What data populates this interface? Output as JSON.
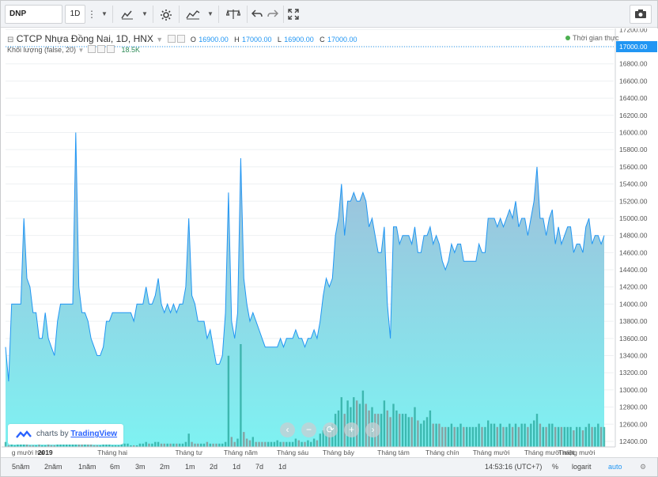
{
  "toolbar": {
    "symbol": "DNP",
    "interval": "1D",
    "icons": [
      "more-icon",
      "compare-icon",
      "settings-icon",
      "indicators-icon",
      "templates-icon",
      "undo-icon",
      "redo-icon",
      "fullscreen-icon",
      "camera-icon"
    ]
  },
  "legend": {
    "title": "CTCP Nhựa Đồng Nai, 1D, HNX",
    "open_label": "O",
    "open": "16900.00",
    "high_label": "H",
    "high": "17000.00",
    "low_label": "L",
    "low": "16900.00",
    "close_label": "C",
    "close": "17000.00",
    "volume_label": "Khối lượng (false, 20)",
    "volume_value": "18.5K",
    "realtime": "Thời gian thực"
  },
  "branding": {
    "prefix": "charts by",
    "name": "TradingView"
  },
  "bottombar": {
    "ranges": [
      "5năm",
      "2năm",
      "1năm",
      "6m",
      "3m",
      "2m",
      "1m",
      "2d",
      "1d",
      "7d",
      "1d"
    ],
    "clock": "14:53:16",
    "timezone": "(UTC+7)",
    "percent": "%",
    "log": "logarit",
    "auto": "auto"
  },
  "colors": {
    "line": "#2196f3",
    "fill_top": "#a3b9d8",
    "fill_bottom": "#7ef2f2",
    "vol_up": "#26a69a",
    "vol_down": "#888888",
    "price_tag": "#2196f3"
  },
  "chart_data": {
    "type": "area",
    "series_ohlc_last": {
      "open": 16900,
      "high": 17000,
      "low": 16900,
      "close": 17000
    },
    "y_ticks": [
      12400,
      12600,
      12800,
      13000,
      13200,
      13400,
      13600,
      13800,
      14000,
      14200,
      14400,
      14600,
      14800,
      15000,
      15200,
      15400,
      15600,
      15800,
      16000,
      16200,
      16400,
      16600,
      16800,
      17000,
      17200
    ],
    "y_tick_labels": [
      "12400.00",
      "12600.00",
      "12800.00",
      "13000.00",
      "13200.00",
      "13400.00",
      "13600.00",
      "13800.00",
      "14000.00",
      "14200.00",
      "14400.00",
      "14600.00",
      "14800.00",
      "15000.00",
      "15200.00",
      "15400.00",
      "15600.00",
      "15800.00",
      "16000.00",
      "16200.00",
      "16400.00",
      "16600.00",
      "16800.00",
      "17000.00",
      "17200.00"
    ],
    "ylim": [
      12300,
      17250
    ],
    "last_price_label": "17000.00",
    "x_labels": [
      {
        "label": "g mười hai",
        "i": 2
      },
      {
        "label": "2019",
        "i": 13
      },
      {
        "label": "Tháng hai",
        "i": 35
      },
      {
        "label": "Tháng tư",
        "i": 60
      },
      {
        "label": "Tháng năm",
        "i": 77
      },
      {
        "label": "Tháng sáu",
        "i": 94
      },
      {
        "label": "Tháng bảy",
        "i": 109
      },
      {
        "label": "Tháng tám",
        "i": 127
      },
      {
        "label": "Tháng chín",
        "i": 143
      },
      {
        "label": "Tháng mười",
        "i": 159
      },
      {
        "label": "Tháng mười một",
        "i": 178
      },
      {
        "label": "Tháng mười",
        "i": 193
      }
    ],
    "close": [
      13500,
      13100,
      14000,
      14000,
      14000,
      14000,
      15000,
      14300,
      14200,
      13900,
      13900,
      13600,
      13600,
      13900,
      13600,
      13500,
      13400,
      13800,
      14000,
      14000,
      14000,
      14000,
      14000,
      16000,
      14200,
      13900,
      13900,
      13800,
      13600,
      13500,
      13400,
      13400,
      13500,
      13800,
      13800,
      13900,
      13900,
      13900,
      13900,
      13900,
      13900,
      13900,
      13800,
      14000,
      14000,
      14000,
      14200,
      14000,
      14000,
      14100,
      14300,
      14000,
      13900,
      14000,
      13900,
      14000,
      13900,
      14000,
      14000,
      14200,
      15000,
      14100,
      14000,
      13800,
      13800,
      13800,
      13600,
      13700,
      13500,
      13300,
      13300,
      13400,
      13900,
      15300,
      13800,
      13600,
      13900,
      15700,
      14300,
      14000,
      13800,
      13900,
      13800,
      13700,
      13600,
      13500,
      13500,
      13500,
      13500,
      13500,
      13600,
      13500,
      13600,
      13600,
      13600,
      13700,
      13600,
      13600,
      13500,
      13600,
      13600,
      13700,
      13600,
      13800,
      14100,
      14300,
      14200,
      14300,
      14800,
      15000,
      15400,
      14800,
      15200,
      15200,
      15300,
      15200,
      15200,
      15300,
      15200,
      14900,
      15000,
      14800,
      14600,
      14600,
      14900,
      14000,
      13600,
      14900,
      14900,
      14700,
      14800,
      14800,
      14800,
      14700,
      14900,
      14600,
      14600,
      14800,
      14800,
      14900,
      14700,
      14800,
      14700,
      14500,
      14400,
      14500,
      14700,
      14600,
      14700,
      14700,
      14500,
      14500,
      14500,
      14500,
      14500,
      14700,
      14600,
      14600,
      15000,
      15000,
      15000,
      14900,
      15000,
      14900,
      15000,
      15100,
      15000,
      15200,
      14900,
      15000,
      15000,
      14800,
      15000,
      15200,
      15600,
      15000,
      15000,
      14800,
      15000,
      15100,
      14700,
      14900,
      14700,
      14800,
      14900,
      14900,
      14600,
      14700,
      14700,
      14600,
      14900,
      15000,
      14700,
      14800,
      14800,
      14700,
      14800
    ],
    "volume_bars_note": "volume histogram drawn along bottom pane (values in arbitrary units read from pane height)",
    "volume": [
      3,
      1,
      2,
      1,
      2,
      2,
      4,
      2,
      1,
      1,
      1,
      2,
      1,
      1,
      2,
      1,
      1,
      2,
      2,
      3,
      2,
      2,
      2,
      10,
      4,
      2,
      3,
      2,
      2,
      1,
      1,
      1,
      2,
      2,
      2,
      1,
      1,
      1,
      2,
      2,
      2,
      1,
      1,
      1,
      2,
      2,
      3,
      2,
      2,
      3,
      3,
      2,
      2,
      2,
      2,
      2,
      2,
      2,
      2,
      3,
      8,
      3,
      2,
      2,
      2,
      2,
      3,
      2,
      2,
      2,
      2,
      2,
      3,
      55,
      6,
      3,
      5,
      62,
      9,
      5,
      4,
      6,
      3,
      3,
      3,
      3,
      3,
      3,
      3,
      4,
      3,
      3,
      3,
      3,
      3,
      5,
      4,
      3,
      3,
      4,
      3,
      5,
      4,
      8,
      10,
      12,
      10,
      14,
      20,
      22,
      30,
      20,
      28,
      24,
      30,
      28,
      26,
      34,
      26,
      22,
      24,
      20,
      20,
      20,
      28,
      22,
      18,
      26,
      22,
      20,
      20,
      20,
      18,
      18,
      24,
      16,
      14,
      16,
      18,
      22,
      14,
      14,
      14,
      12,
      12,
      12,
      14,
      12,
      12,
      14,
      12,
      12,
      12,
      12,
      12,
      14,
      12,
      12,
      16,
      14,
      14,
      12,
      14,
      12,
      12,
      14,
      12,
      14,
      12,
      14,
      14,
      12,
      14,
      16,
      20,
      14,
      12,
      12,
      14,
      14,
      12,
      12,
      12,
      12,
      12,
      12,
      10,
      12,
      12,
      10,
      12,
      14,
      12,
      12,
      14,
      12,
      12
    ]
  }
}
